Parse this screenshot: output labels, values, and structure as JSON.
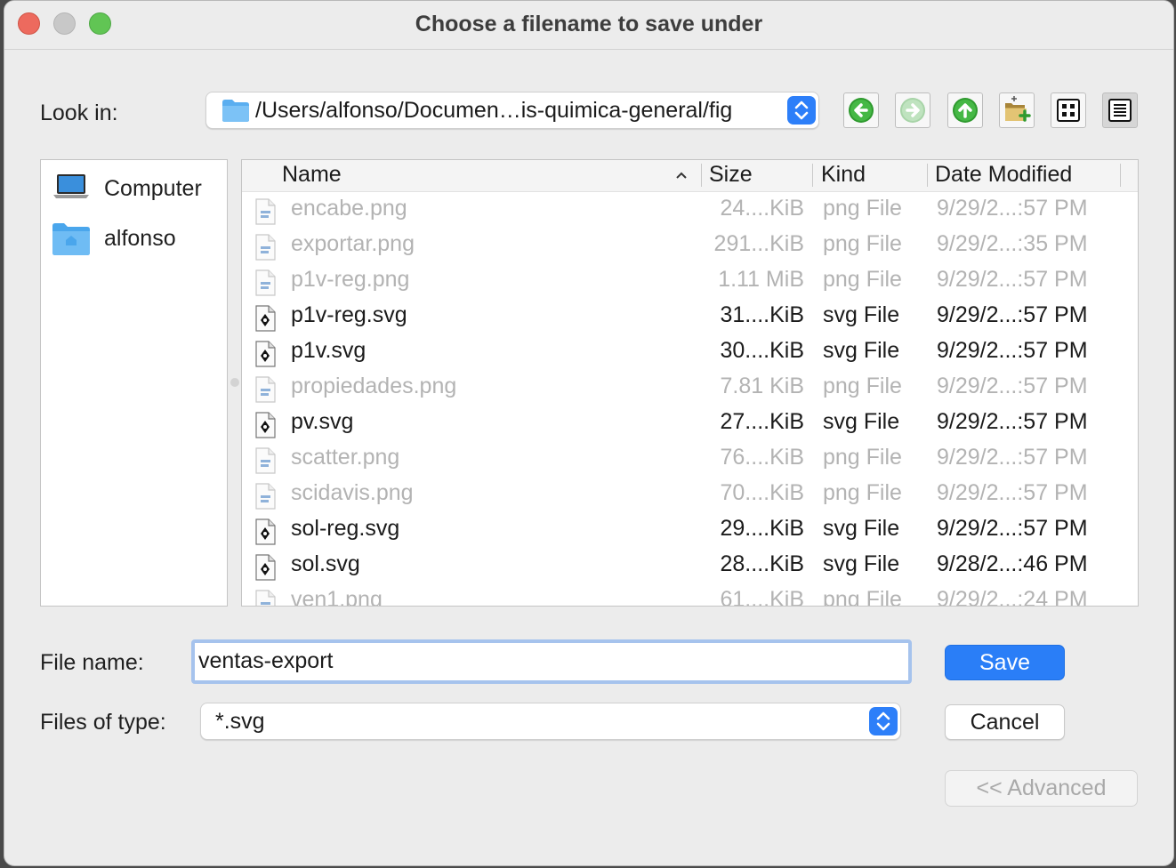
{
  "window": {
    "title": "Choose a filename to save under"
  },
  "look_in": {
    "label": "Look in:",
    "path": "/Users/alfonso/Documen…is-quimica-general/fig"
  },
  "toolbar": {
    "back": "back-icon",
    "forward": "forward-icon",
    "parent": "parent-directory-icon",
    "new_folder": "new-folder-icon",
    "list_mode": "list-view-icon",
    "detail_mode": "detail-view-icon"
  },
  "sidebar": {
    "items": [
      {
        "label": "Computer",
        "icon": "laptop-icon"
      },
      {
        "label": "alfonso",
        "icon": "home-folder-icon"
      }
    ]
  },
  "filelist": {
    "columns": {
      "name": "Name",
      "size": "Size",
      "kind": "Kind",
      "date": "Date Modified"
    },
    "rows": [
      {
        "name": "encabe.png",
        "size": "24....KiB",
        "kind": "png File",
        "date": "9/29/2...:57 PM",
        "enabled": false
      },
      {
        "name": "exportar.png",
        "size": "291...KiB",
        "kind": "png File",
        "date": "9/29/2...:35 PM",
        "enabled": false
      },
      {
        "name": "p1v-reg.png",
        "size": "1.11 MiB",
        "kind": "png File",
        "date": "9/29/2...:57 PM",
        "enabled": false
      },
      {
        "name": "p1v-reg.svg",
        "size": "31....KiB",
        "kind": "svg File",
        "date": "9/29/2...:57 PM",
        "enabled": true
      },
      {
        "name": "p1v.svg",
        "size": "30....KiB",
        "kind": "svg File",
        "date": "9/29/2...:57 PM",
        "enabled": true
      },
      {
        "name": "propiedades.png",
        "size": "7.81 KiB",
        "kind": "png File",
        "date": "9/29/2...:57 PM",
        "enabled": false
      },
      {
        "name": "pv.svg",
        "size": "27....KiB",
        "kind": "svg File",
        "date": "9/29/2...:57 PM",
        "enabled": true
      },
      {
        "name": "scatter.png",
        "size": "76....KiB",
        "kind": "png File",
        "date": "9/29/2...:57 PM",
        "enabled": false
      },
      {
        "name": "scidavis.png",
        "size": "70....KiB",
        "kind": "png File",
        "date": "9/29/2...:57 PM",
        "enabled": false
      },
      {
        "name": "sol-reg.svg",
        "size": "29....KiB",
        "kind": "svg File",
        "date": "9/29/2...:57 PM",
        "enabled": true
      },
      {
        "name": "sol.svg",
        "size": "28....KiB",
        "kind": "svg File",
        "date": "9/28/2...:46 PM",
        "enabled": true
      },
      {
        "name": "ven1.png",
        "size": "61....KiB",
        "kind": "png File",
        "date": "9/29/2...:24 PM",
        "enabled": false
      }
    ]
  },
  "filename": {
    "label": "File name:",
    "value": "ventas-export"
  },
  "filetype": {
    "label": "Files of type:",
    "value": "*.svg"
  },
  "buttons": {
    "save": "Save",
    "cancel": "Cancel",
    "advanced": "<< Advanced"
  },
  "colors": {
    "accent": "#2a7ef7",
    "dim_text": "#b3b3b3"
  }
}
